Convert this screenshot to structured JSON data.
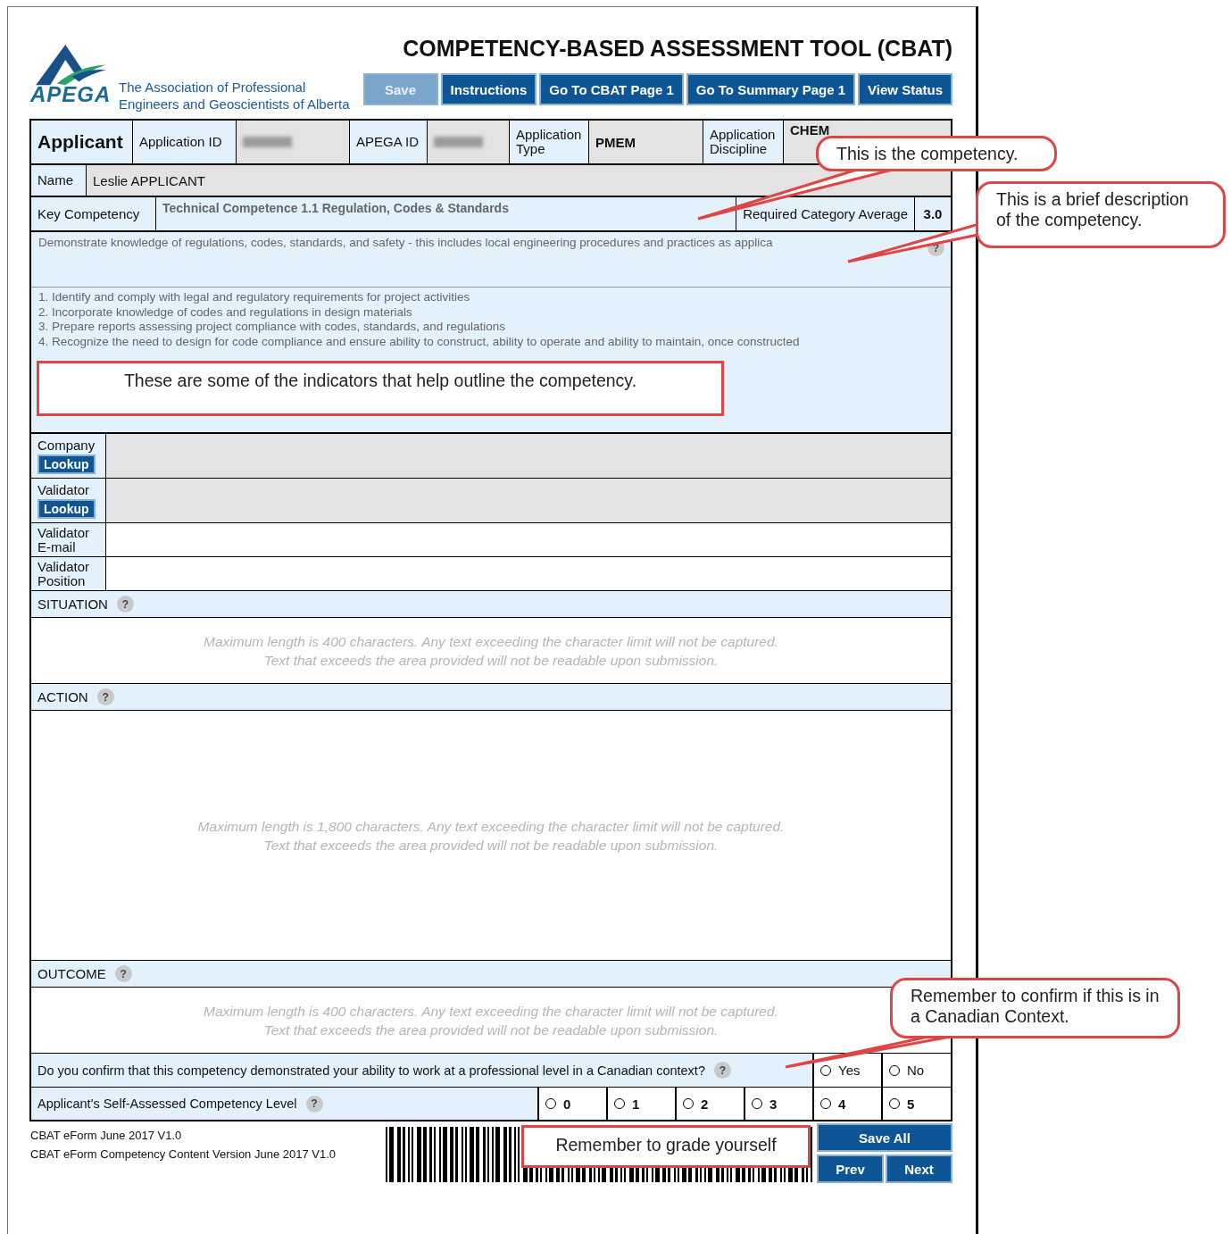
{
  "header": {
    "logo_text": "APEGA",
    "tagline": [
      "The Association of Professional",
      "Engineers and Geoscientists of Alberta"
    ],
    "title": "COMPETENCY-BASED ASSESSMENT TOOL (CBAT)",
    "buttons": [
      {
        "label": "Save",
        "disabled": true
      },
      {
        "label": "Instructions",
        "disabled": false
      },
      {
        "label": "Go To CBAT Page 1",
        "disabled": false
      },
      {
        "label": "Go To Summary Page 1",
        "disabled": false
      },
      {
        "label": "View Status",
        "disabled": false
      }
    ]
  },
  "applicant": {
    "heading": "Applicant",
    "fields": [
      {
        "label": "Application ID",
        "redacted": true
      },
      {
        "label": "APEGA ID",
        "redacted": true
      },
      {
        "label": "Application Type",
        "value": "PMEM",
        "redacted": false
      },
      {
        "label": "Application Discipline",
        "value": "CHEM",
        "redacted": false
      }
    ]
  },
  "name": {
    "label": "Name",
    "value": "Leslie APPLICANT"
  },
  "key_competency": {
    "label": "Key Competency",
    "value": "Technical Competence 1.1 Regulation, Codes & Standards",
    "required_label": "Required Category Average",
    "required_value": "3.0"
  },
  "description_help": "?",
  "description": "Demonstrate knowledge of regulations, codes, standards, and safety - this includes local engineering procedures and practices as applica",
  "indicators": [
    "1. Identify and comply with legal and regulatory requirements for project activities",
    "2. Incorporate knowledge of codes and regulations in design materials",
    "3. Prepare reports assessing project compliance with codes, standards, and regulations",
    "4. Recognize the need to design for code compliance and ensure ability to construct, ability to operate and ability to maintain, once constructed"
  ],
  "validator_fields": [
    {
      "label": "Company",
      "button": "Lookup"
    },
    {
      "label": "Validator",
      "button": "Lookup"
    },
    {
      "label": "Validator E-mail"
    },
    {
      "label": "Validator Position"
    }
  ],
  "sections": [
    {
      "title": "SITUATION",
      "help": "?",
      "placeholder": [
        "Maximum length is 400 characters. Any text exceeding the character limit will not be captured.",
        "Text that exceeds the area provided will not be readable upon submission."
      ]
    },
    {
      "title": "ACTION",
      "help": "?",
      "placeholder": [
        "Maximum length is 1,800 characters. Any text exceeding the character limit will not be captured.",
        "Text that exceeds the area provided will not be readable upon submission."
      ]
    },
    {
      "title": "OUTCOME",
      "help": "?",
      "placeholder": [
        "Maximum length is 400 characters. Any text exceeding the character limit will not be captured.",
        "Text that exceeds the area provided will not be readable upon submission."
      ]
    }
  ],
  "confirm": {
    "question": "Do you confirm that this competency demonstrated your ability to work at a professional level in a Canadian context?",
    "help": "?",
    "options": [
      {
        "label": "Yes",
        "selected": false
      },
      {
        "label": "No",
        "selected": false
      }
    ]
  },
  "level": {
    "label": "Applicant's Self-Assessed Competency Level",
    "help": "?",
    "options": [
      {
        "label": "0",
        "selected": false
      },
      {
        "label": "1",
        "selected": false
      },
      {
        "label": "2",
        "selected": false
      },
      {
        "label": "3",
        "selected": false
      },
      {
        "label": "4",
        "selected": false
      },
      {
        "label": "5",
        "selected": false
      }
    ]
  },
  "footer": {
    "versions": [
      "CBAT eForm June 2017 V1.0",
      "CBAT eForm Competency Content Version June 2017 V1.0"
    ],
    "buttons": [
      "Save All",
      "Prev",
      "Next"
    ]
  },
  "callouts": [
    {
      "kind": "bubble",
      "text": "This is the competency."
    },
    {
      "kind": "bubble",
      "text": "This is a brief description of the competency."
    },
    {
      "kind": "box",
      "text": "These are some of the indicators that help outline the competency."
    },
    {
      "kind": "bubble",
      "text": "Remember to confirm if this is in a Canadian Context."
    },
    {
      "kind": "box",
      "text": "Remember to grade yourself"
    }
  ]
}
